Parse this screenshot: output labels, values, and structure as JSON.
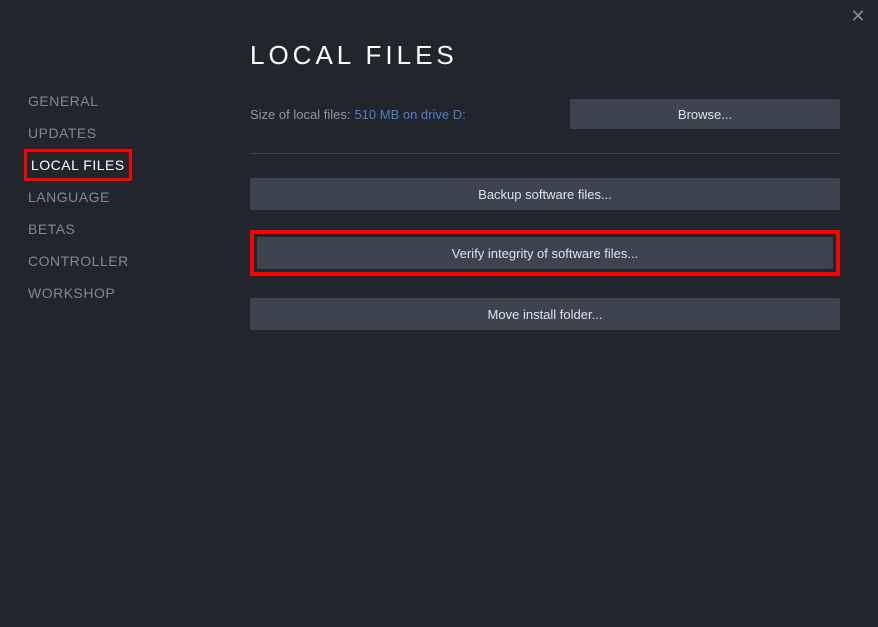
{
  "close_label": "✕",
  "sidebar": {
    "items": [
      {
        "label": "GENERAL",
        "active": false
      },
      {
        "label": "UPDATES",
        "active": false
      },
      {
        "label": "LOCAL FILES",
        "active": true
      },
      {
        "label": "LANGUAGE",
        "active": false
      },
      {
        "label": "BETAS",
        "active": false
      },
      {
        "label": "CONTROLLER",
        "active": false
      },
      {
        "label": "WORKSHOP",
        "active": false
      }
    ]
  },
  "main": {
    "title": "LOCAL FILES",
    "size_label": "Size of local files:",
    "size_value": "510 MB on drive D:",
    "browse_label": "Browse...",
    "backup_label": "Backup software files...",
    "verify_label": "Verify integrity of software files...",
    "move_label": "Move install folder..."
  }
}
